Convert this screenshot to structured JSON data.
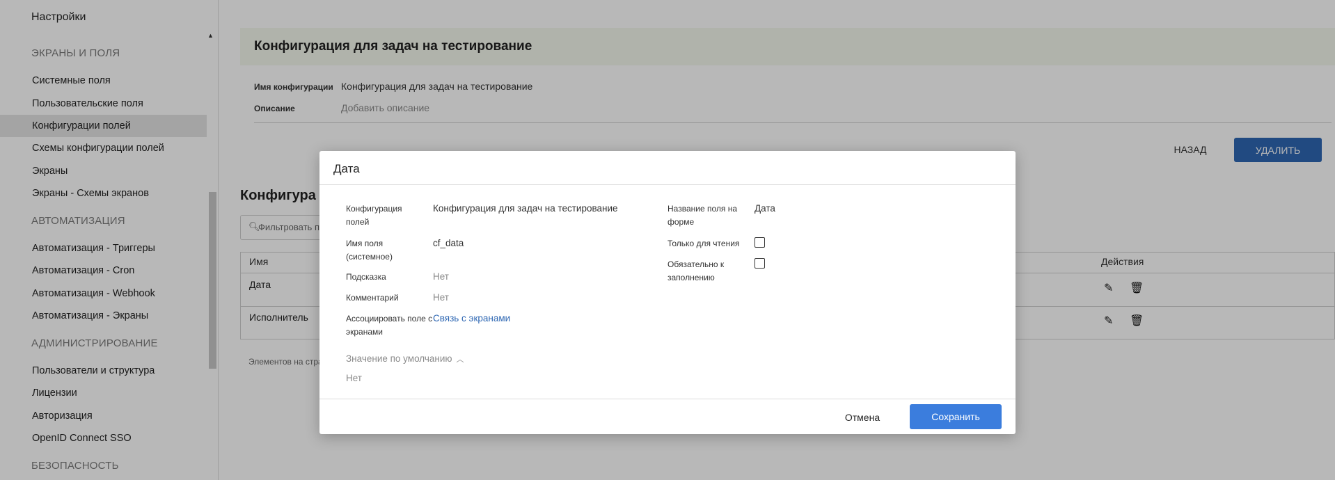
{
  "sidebar": {
    "title": "Настройки",
    "sections": [
      {
        "label": "ЭКРАНЫ И ПОЛЯ"
      },
      {
        "label": "АВТОМАТИЗАЦИЯ"
      },
      {
        "label": "АДМИНИСТРИРОВАНИЕ"
      },
      {
        "label": "БЕЗОПАСНОСТЬ"
      }
    ],
    "items": [
      {
        "label": "Системные поля"
      },
      {
        "label": "Пользовательские поля"
      },
      {
        "label": "Конфигурации полей",
        "active": true
      },
      {
        "label": "Схемы конфигурации полей"
      },
      {
        "label": "Экраны"
      },
      {
        "label": "Экраны - Схемы экранов"
      },
      {
        "label": "Автоматизация - Триггеры"
      },
      {
        "label": "Автоматизация - Cron"
      },
      {
        "label": "Автоматизация - Webhook"
      },
      {
        "label": "Автоматизация - Экраны"
      },
      {
        "label": "Пользователи и структура"
      },
      {
        "label": "Лицензии"
      },
      {
        "label": "Авторизация"
      },
      {
        "label": "OpenID Connect SSO"
      }
    ]
  },
  "main": {
    "title": "Конфигурация для задач на тестирование",
    "meta": {
      "name_label": "Имя конфигурации",
      "name_value": "Конфигурация для задач на тестирование",
      "desc_label": "Описание",
      "desc_value": "Добавить описание"
    },
    "back_label": "НАЗАД",
    "delete_label": "УДАЛИТЬ",
    "section_title": "Конфигура",
    "filter_placeholder": "Фильтровать п",
    "table": {
      "col_name": "Имя",
      "col_actions": "Действия",
      "rows": [
        {
          "name": "Дата"
        },
        {
          "name": "Исполнитель"
        }
      ]
    },
    "pager_label": "Элементов на стра"
  },
  "modal": {
    "title": "Дата",
    "fields": {
      "config_label": "Конфигурация полей",
      "config_value": "Конфигурация для задач на тестирование",
      "sysname_label": "Имя поля (системное)",
      "sysname_value": "cf_data",
      "hint_label": "Подсказка",
      "hint_value": "Нет",
      "comment_label": "Комментарий",
      "comment_value": "Нет",
      "assoc_label": "Ассоциировать поле с экранами",
      "assoc_link": "Связь с экранами",
      "formname_label": "Название поля на форме",
      "formname_value": "Дата",
      "readonly_label": "Только для чтения",
      "readonly_checked": false,
      "required_label": "Обязательно к заполнению",
      "required_checked": false
    },
    "default_label": "Значение по умолчанию",
    "default_value": "Нет",
    "cancel_label": "Отмена",
    "save_label": "Сохранить"
  },
  "colors": {
    "primary": "#3b7ddd",
    "delete_button": "#2e67b3",
    "header_bg": "#f4f8ee",
    "active_item_bg": "#e3e3e3"
  }
}
